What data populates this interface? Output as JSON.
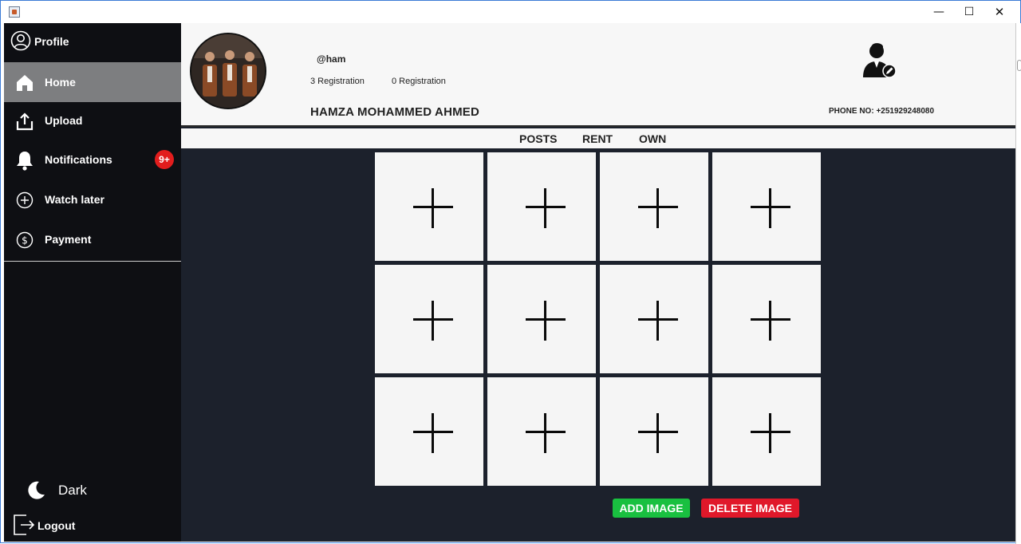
{
  "window": {
    "icons": {
      "app": "java-cup-icon",
      "minimize": "minimize-icon",
      "maximize": "maximize-icon",
      "close": "close-icon"
    },
    "controls": {
      "minimize": "—",
      "maximize": "☐",
      "close": "✕"
    }
  },
  "sidebar": {
    "profile": {
      "label": "Profile",
      "icon": "user-circle-icon"
    },
    "items": [
      {
        "label": "Home",
        "icon": "home-icon",
        "active": true
      },
      {
        "label": "Upload",
        "icon": "upload-icon"
      },
      {
        "label": "Notifications",
        "icon": "bell-icon",
        "badge": "9+"
      },
      {
        "label": "Watch later",
        "icon": "plus-circle-icon"
      },
      {
        "label": "Payment",
        "icon": "dollar-circle-icon"
      }
    ],
    "theme": {
      "label": "Dark",
      "icon": "moon-icon"
    },
    "logout": {
      "label": "Logout",
      "icon": "logout-icon"
    }
  },
  "profile": {
    "handle": "@ham",
    "registration_left": "3 Registration",
    "registration_right": "0 Registration",
    "full_name": "HAMZA MOHAMMED AHMED",
    "phone": "PHONE NO: +251929248080",
    "avatar": "profile-photo",
    "edit_icon": "edit-user-icon"
  },
  "tabs": [
    "POSTS",
    "RENT",
    "OWN"
  ],
  "grid": {
    "rows": 3,
    "cols": 4,
    "cell_icon": "plus-icon"
  },
  "actions": {
    "add_label": "ADD IMAGE",
    "delete_label": "DELETE IMAGE"
  },
  "colors": {
    "sidebar_bg": "#0e0f13",
    "active_item": "#7d7e80",
    "main_bg": "#1c212c",
    "badge": "#e21d1d",
    "add": "#19c040",
    "delete": "#e0182a"
  }
}
